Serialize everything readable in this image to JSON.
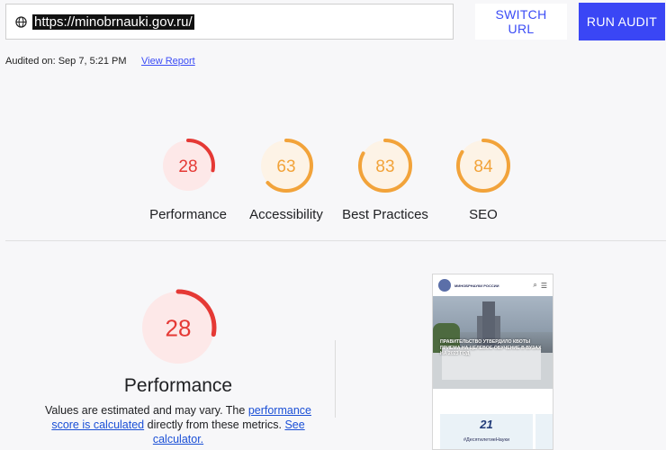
{
  "toolbar": {
    "url": "https://minobrnauki.gov.ru/",
    "switch_label": "SWITCH URL",
    "run_label": "RUN AUDIT"
  },
  "meta": {
    "audited": "Audited on: Sep 7, 5:21 PM",
    "view_report": "View Report"
  },
  "scores": [
    {
      "label": "Performance",
      "value": "28",
      "fraction": 0.28,
      "color": "#e53935",
      "bg": "#fde8e8"
    },
    {
      "label": "Accessibility",
      "value": "63",
      "fraction": 0.63,
      "color": "#f2a33a",
      "bg": "#fdf3e6"
    },
    {
      "label": "Best Practices",
      "value": "83",
      "fraction": 0.83,
      "color": "#f2a33a",
      "bg": "#fdf3e6"
    },
    {
      "label": "SEO",
      "value": "84",
      "fraction": 0.84,
      "color": "#f2a33a",
      "bg": "#fdf3e6"
    }
  ],
  "detail": {
    "score": "28",
    "fraction": 0.28,
    "title": "Performance",
    "desc_1": "Values are estimated and may vary. The ",
    "link_1": "performance score is calculated",
    "desc_2": " directly from these metrics. ",
    "link_2": "See calculator."
  },
  "preview": {
    "site_title": "МИНОБРНАУКИ РОССИИ",
    "headline": "ПРАВИТЕЛЬСТВО УТВЕРДИЛО КВОТЫ ПРИЕМА НА ЦЕЛЕВОЕ ОБУЧЕНИЕ В ВУЗАХ НА 2023 ГОД",
    "card_logo": "21",
    "card_text": "#ДесятилетиеНауки"
  }
}
